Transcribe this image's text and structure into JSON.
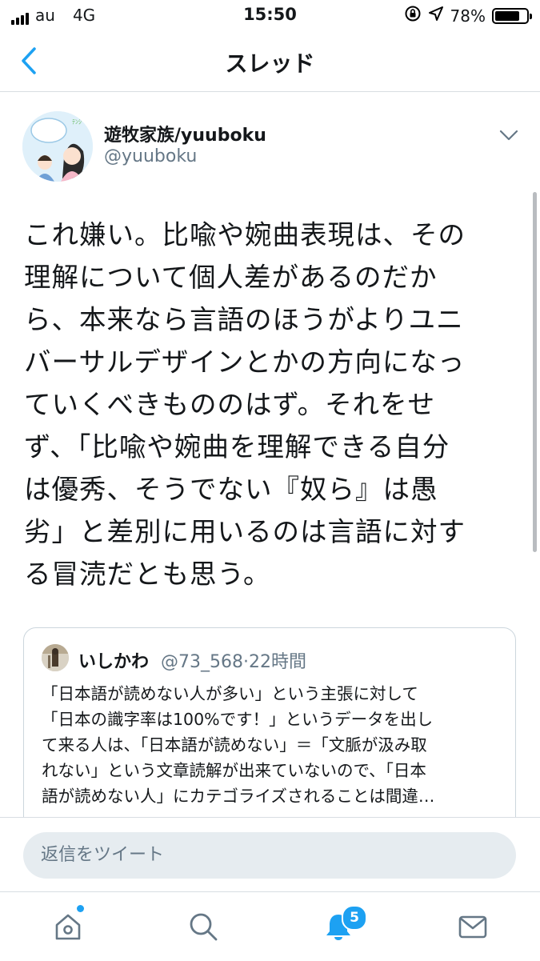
{
  "status_bar": {
    "carrier": "au",
    "network": "4G",
    "time": "15:50",
    "battery_percent": "78%",
    "battery_level": 0.78
  },
  "nav": {
    "title": "スレッド"
  },
  "tweet": {
    "author_name": "遊牧家族/yuuboku",
    "author_handle": "@yuuboku",
    "text": "これ嫌い。比喩や婉曲表現は、その\n理解について個人差があるのだか\nら、本来なら言語のほうがよりユニ\nバーサルデザインとかの方向になっ\nていくべきもののはず。それをせ\nず、「比喩や婉曲を理解できる自分\nは優秀、そうでない『奴ら』は愚\n劣」と差別に用いるのは言語に対す\nる冒涜だとも思う。",
    "quote": {
      "author_name": "いしかわ",
      "author_handle": "@73_568",
      "separator": "·",
      "time": "22時間",
      "text": "「日本語が読めない人が多い」という主張に対して\n「日本の識字率は100%です！」というデータを出し\nて来る人は、「日本語が読めない」＝「文脈が汲み取\nれない」という文章読解が出来ていないので、「日本\n語が読めない人」にカテゴライズされることは間違…"
    }
  },
  "reply": {
    "placeholder": "返信をツイート"
  },
  "tabbar": {
    "notifications_badge": "5",
    "icons": [
      "home-icon",
      "search-icon",
      "notifications-bell-icon",
      "messages-icon"
    ]
  },
  "colors": {
    "accent": "#1da1f2",
    "muted": "#657786",
    "divider": "#d8dde2"
  }
}
